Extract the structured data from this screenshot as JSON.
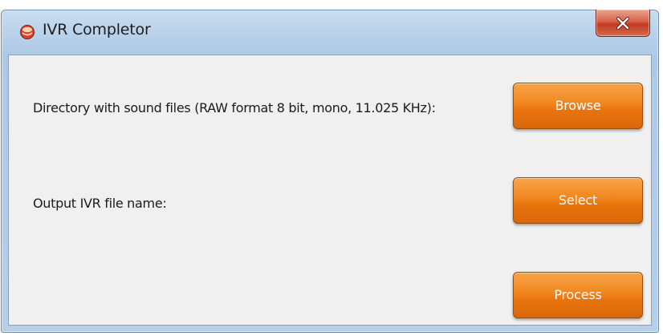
{
  "window": {
    "title": "IVR Completor",
    "icon": "app-logo-icon",
    "close_icon": "close-icon"
  },
  "form": {
    "directory_label": "Directory with sound files (RAW format 8 bit, mono, 11.025 KHz):",
    "output_label": "Output IVR file name:",
    "browse_label": "Browse",
    "select_label": "Select",
    "process_label": "Process"
  },
  "colors": {
    "button_orange": "#f28a24",
    "close_red": "#c23a22",
    "frame_blue": "#b9d1ea"
  }
}
